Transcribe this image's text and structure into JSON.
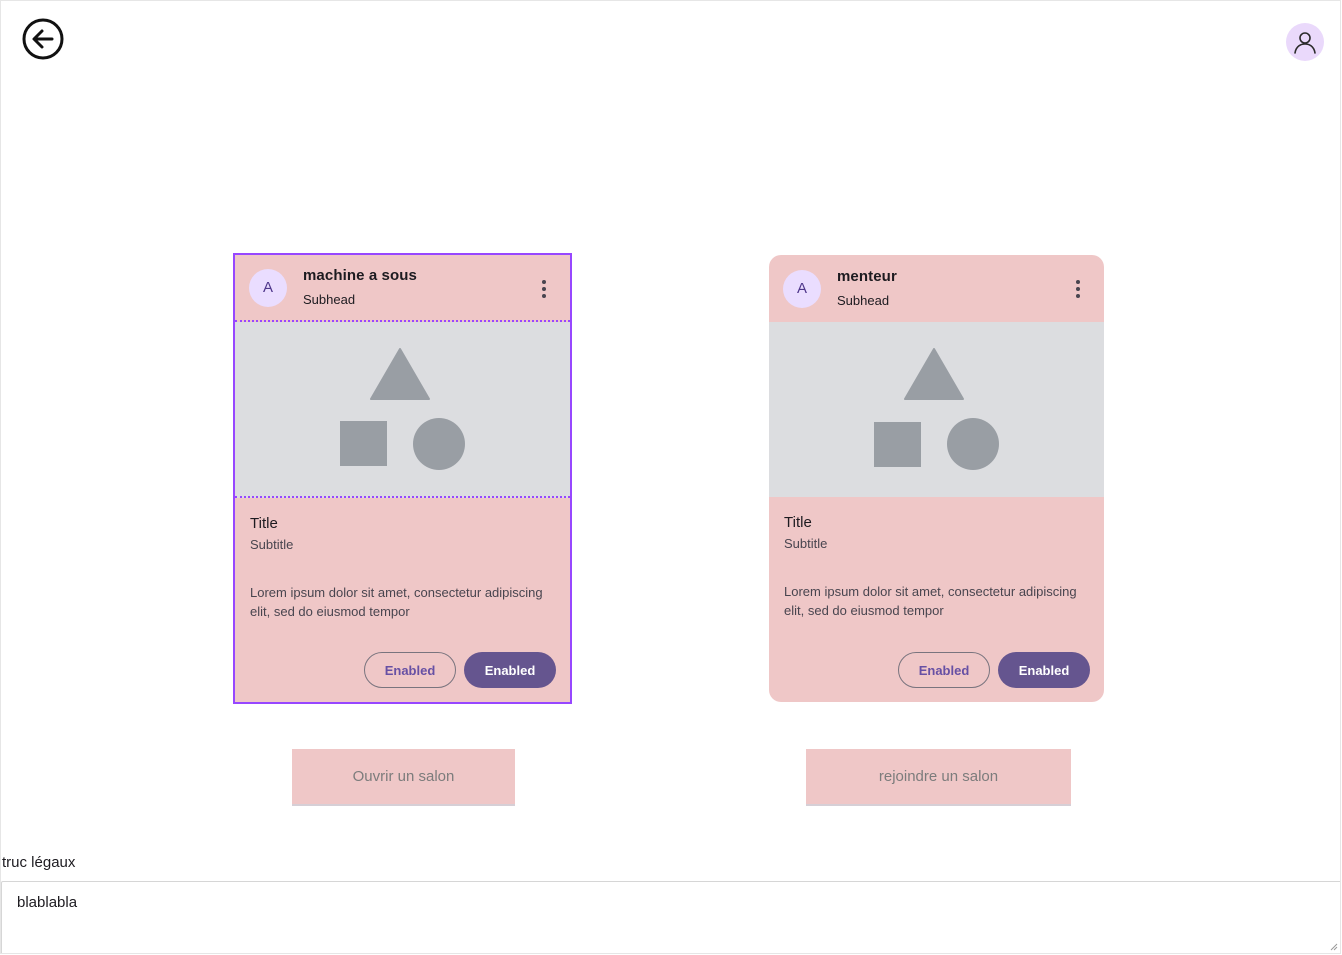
{
  "topbar": {
    "back_icon": "arrow-left-circle-icon",
    "profile_icon": "user-icon"
  },
  "cards": [
    {
      "avatar_letter": "A",
      "header_title": "machine a sous",
      "header_subhead": "Subhead",
      "title": "Title",
      "subtitle": "Subtitle",
      "text": "Lorem ipsum dolor sit amet, consectetur adipiscing elit, sed do eiusmod tempor",
      "outline_button": "Enabled",
      "filled_button": "Enabled"
    },
    {
      "avatar_letter": "A",
      "header_title": "menteur",
      "header_subhead": "Subhead",
      "title": "Title",
      "subtitle": "Subtitle",
      "text": "Lorem ipsum dolor sit amet, consectetur adipiscing elit, sed do eiusmod tempor",
      "outline_button": "Enabled",
      "filled_button": "Enabled"
    }
  ],
  "actions": {
    "open_salon": "Ouvrir un salon",
    "join_salon": "rejoindre un salon"
  },
  "legal": {
    "label": "truc légaux",
    "text": "blablabla"
  },
  "colors": {
    "card_bg": "#efc7c7",
    "media_bg": "#dcdde0",
    "primary": "#65558f",
    "selection": "#9747ff"
  }
}
